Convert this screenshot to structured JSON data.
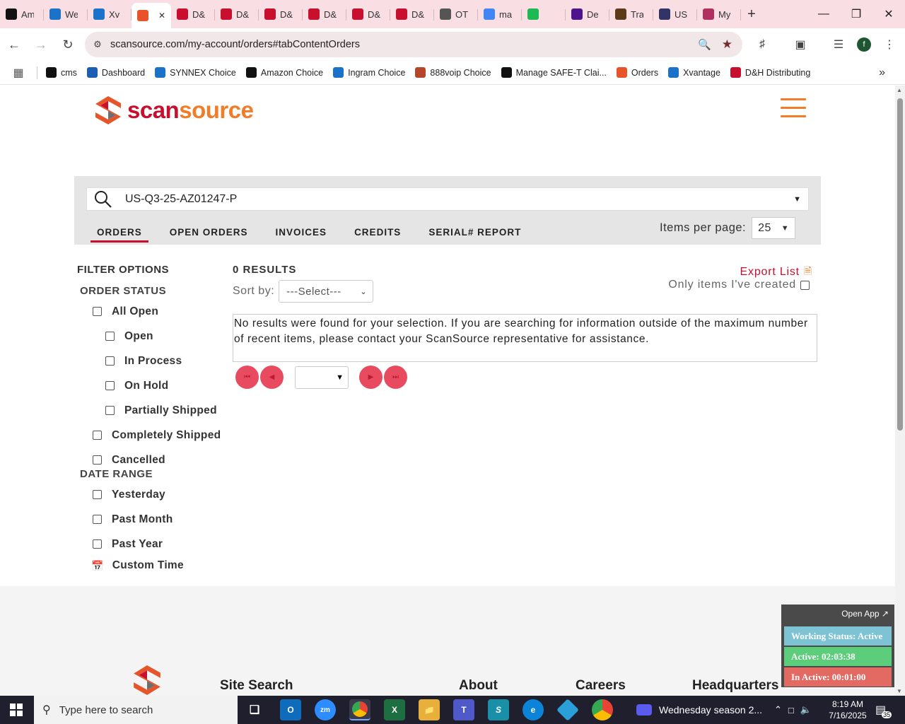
{
  "browser": {
    "tabs": [
      {
        "label": "Am",
        "icon": "amazon-icon",
        "color": "#111111"
      },
      {
        "label": "We",
        "icon": "ec-icon",
        "color": "#1a73c8"
      },
      {
        "label": "Xv",
        "icon": "xvantage-icon",
        "color": "#1a73c8"
      },
      {
        "label": "",
        "icon": "scansource-icon",
        "color": "#e8542a",
        "active": true
      },
      {
        "label": "D&",
        "icon": "dh-icon",
        "color": "#c8102e"
      },
      {
        "label": "D&",
        "icon": "dh-icon",
        "color": "#c8102e"
      },
      {
        "label": "D&",
        "icon": "dh-icon",
        "color": "#c8102e"
      },
      {
        "label": "D&",
        "icon": "dh-icon",
        "color": "#c8102e"
      },
      {
        "label": "D&",
        "icon": "dh-icon",
        "color": "#c8102e"
      },
      {
        "label": "D&",
        "icon": "dh-icon",
        "color": "#c8102e"
      },
      {
        "label": "OT",
        "icon": "car-icon",
        "color": "#555555"
      },
      {
        "label": "ma",
        "icon": "google-icon",
        "color": "#4285f4"
      },
      {
        "label": "",
        "icon": "spotify-icon",
        "color": "#1db954"
      },
      {
        "label": "De",
        "icon": "fedex-icon",
        "color": "#4d148c"
      },
      {
        "label": "Tra",
        "icon": "ups-icon",
        "color": "#5b3a1a"
      },
      {
        "label": "US",
        "icon": "usps-icon",
        "color": "#333366"
      },
      {
        "label": "My",
        "icon": "profile-icon",
        "color": "#b03060"
      }
    ],
    "url": "scansource.com/my-account/orders#tabContentOrders",
    "profile_initial": "f",
    "bookmarks": [
      {
        "label": "cms",
        "color": "#111111"
      },
      {
        "label": "Dashboard",
        "color": "#1a5fb4"
      },
      {
        "label": "SYNNEX Choice",
        "color": "#1a73c8"
      },
      {
        "label": "Amazon Choice",
        "color": "#111111"
      },
      {
        "label": "Ingram Choice",
        "color": "#1a73c8"
      },
      {
        "label": "888voip Choice",
        "color": "#b5462a"
      },
      {
        "label": "Manage SAFE-T Clai...",
        "color": "#111111"
      },
      {
        "label": "Orders",
        "color": "#e8542a"
      },
      {
        "label": "Xvantage",
        "color": "#1a73c8"
      },
      {
        "label": "D&H Distributing",
        "color": "#c8102e"
      }
    ]
  },
  "site": {
    "logo_text_1": "scan",
    "logo_text_2": "source",
    "search_value": "US-Q3-25-AZ01247-P",
    "tabs": [
      "ORDERS",
      "OPEN ORDERS",
      "INVOICES",
      "CREDITS",
      "SERIAL# REPORT"
    ],
    "items_per_page_label": "Items per page:",
    "items_per_page_value": "25",
    "filter_title": "FILTER OPTIONS",
    "order_status_title": "ORDER STATUS",
    "order_status": [
      {
        "label": "All Open",
        "indent": false
      },
      {
        "label": "Open",
        "indent": true
      },
      {
        "label": "In Process",
        "indent": true
      },
      {
        "label": "On Hold",
        "indent": true
      },
      {
        "label": "Partially Shipped",
        "indent": true
      },
      {
        "label": "Completely Shipped",
        "indent": false
      },
      {
        "label": "Cancelled",
        "indent": false
      }
    ],
    "date_range_title": "DATE RANGE",
    "date_range": [
      "Yesterday",
      "Past Month",
      "Past Year"
    ],
    "custom_time": "Custom Time",
    "results_count": "0 RESULTS",
    "sort_label": "Sort by:",
    "sort_value": "---Select---",
    "export_label": "Export List",
    "only_mine_label": "Only items I've created",
    "no_results_message": "No results were found for your selection. If you are searching for information outside of the maximum number of recent items, please contact your ScanSource representative for assistance.",
    "footer_columns": [
      "Site Search",
      "About",
      "Careers",
      "Headquarters"
    ]
  },
  "widget": {
    "open_app": "Open App ↗",
    "working_status": "Working Status: Active",
    "active": "Active: 02:03:38",
    "inactive": "In Active: 00:01:00",
    "color_status": "#7ec3d3",
    "color_active": "#5ccd7a",
    "color_inactive": "#e26a62"
  },
  "taskbar": {
    "search_placeholder": "Type here to search",
    "media_title": "Wednesday season 2...",
    "time": "8:19 AM",
    "date": "7/16/2025",
    "notification_count": "35"
  }
}
